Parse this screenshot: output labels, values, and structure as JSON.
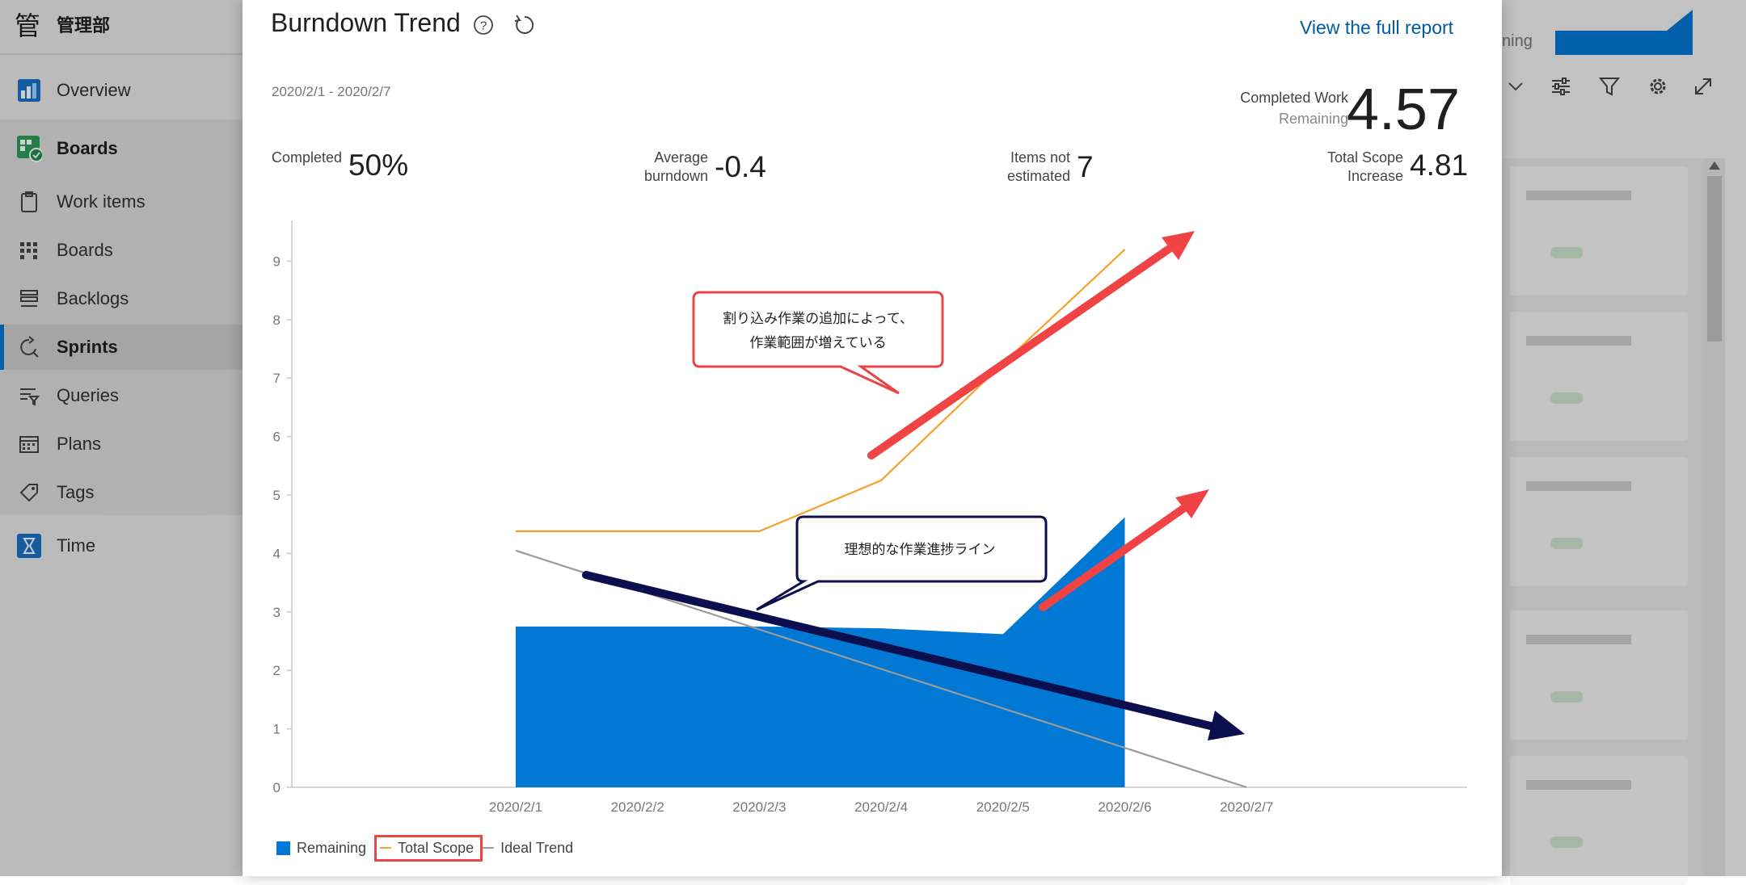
{
  "sidebar": {
    "org_name": "管理部",
    "org_logo": "管",
    "items": [
      {
        "label": "Overview",
        "icon": "overview-icon"
      },
      {
        "label": "Boards",
        "icon": "boards-hub-icon"
      },
      {
        "label": "Work items",
        "icon": "clipboard-icon"
      },
      {
        "label": "Boards",
        "icon": "board-grid-icon"
      },
      {
        "label": "Backlogs",
        "icon": "backlog-icon"
      },
      {
        "label": "Sprints",
        "icon": "sprint-icon"
      },
      {
        "label": "Queries",
        "icon": "query-funnel-icon"
      },
      {
        "label": "Plans",
        "icon": "calendar-icon"
      },
      {
        "label": "Tags",
        "icon": "tag-icon"
      },
      {
        "label": "Time",
        "icon": "hourglass-icon"
      }
    ]
  },
  "background": {
    "mini_tab": "ning"
  },
  "dialog": {
    "title": "Burndown Trend",
    "full_report_link": "View the full report",
    "date_range": "2020/2/1 - 2020/2/7",
    "completed_work_label": "Completed Work",
    "remaining_label": "Remaining",
    "completed_work_value": "4.57",
    "metrics": {
      "completed": {
        "label": "Completed",
        "value": "50%"
      },
      "average_burndown": {
        "label_1": "Average",
        "label_2": "burndown",
        "value": "-0.4"
      },
      "items_not_estimated": {
        "label_1": "Items not",
        "label_2": "estimated",
        "value": "7"
      },
      "total_scope_increase": {
        "label_1": "Total Scope",
        "label_2": "Increase",
        "value": "4.81"
      }
    },
    "annotations": {
      "scope_callout": [
        "割り込み作業の追加によって、",
        "作業範囲が増えている"
      ],
      "ideal_callout": "理想的な作業進捗ライン"
    },
    "legend": {
      "remaining": "Remaining",
      "total_scope": "Total Scope",
      "ideal_trend": "Ideal Trend"
    }
  },
  "colors": {
    "remaining": "#0078d4",
    "total_scope": "#f7a128",
    "ideal_trend": "#9b9b9b",
    "red_arrow": "#f04444",
    "navy_arrow": "#0b0f4d",
    "link": "#005a9e"
  },
  "chart_data": {
    "type": "area",
    "categories": [
      "2020/2/1",
      "2020/2/2",
      "2020/2/3",
      "2020/2/4",
      "2020/2/5",
      "2020/2/6",
      "2020/2/7"
    ],
    "ylim": [
      0,
      9.6
    ],
    "yticks": [
      0,
      1,
      2,
      3,
      4,
      5,
      6,
      7,
      8,
      9
    ],
    "grid": false,
    "legend_position": "bottom-left",
    "series": [
      {
        "name": "Remaining",
        "type": "area",
        "values": [
          2.75,
          2.75,
          2.75,
          2.72,
          2.62,
          4.62,
          null
        ]
      },
      {
        "name": "Total Scope",
        "type": "line",
        "values": [
          4.38,
          4.38,
          4.38,
          5.25,
          7.25,
          9.2,
          null
        ]
      },
      {
        "name": "Ideal Trend",
        "type": "line",
        "values": [
          4.05,
          3.375,
          2.7,
          2.025,
          1.35,
          0.675,
          0
        ]
      }
    ]
  }
}
